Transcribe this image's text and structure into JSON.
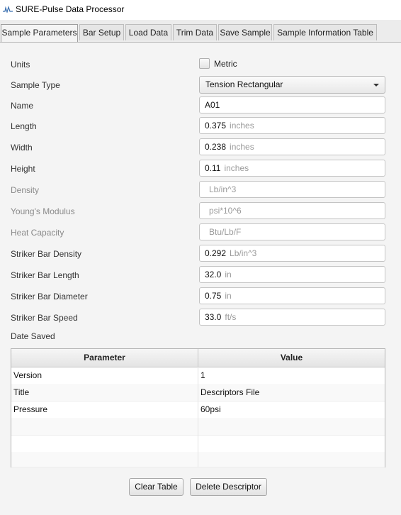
{
  "window": {
    "title": "SURE-Pulse Data Processor",
    "icon": "app-logo-icon"
  },
  "tabs": [
    {
      "label": "Sample Parameters",
      "active": true
    },
    {
      "label": "Bar Setup"
    },
    {
      "label": "Load Data"
    },
    {
      "label": "Trim Data"
    },
    {
      "label": "Save Sample"
    },
    {
      "label": "Sample Information Table"
    }
  ],
  "form": {
    "units_label": "Units",
    "metric_label": "Metric",
    "metric_checked": false,
    "sample_type_label": "Sample Type",
    "sample_type_value": "Tension Rectangular",
    "fields": [
      {
        "label": "Name",
        "value": "A01",
        "unit": ""
      },
      {
        "label": "Length",
        "value": "0.375",
        "unit": "inches"
      },
      {
        "label": "Width",
        "value": "0.238",
        "unit": "inches"
      },
      {
        "label": "Height",
        "value": "0.11",
        "unit": "inches"
      },
      {
        "label": "Density",
        "value": "",
        "unit": "Lb/in^3"
      },
      {
        "label": "Young's Modulus",
        "value": "",
        "unit": "psi*10^6"
      },
      {
        "label": "Heat Capacity",
        "value": "",
        "unit": "Btu/Lb/F"
      },
      {
        "label": "Striker Bar Density",
        "value": "0.292",
        "unit": "Lb/in^3"
      },
      {
        "label": "Striker Bar Length",
        "value": "32.0",
        "unit": "in"
      },
      {
        "label": "Striker Bar Diameter",
        "value": "0.75",
        "unit": "in"
      },
      {
        "label": "Striker Bar Speed",
        "value": "33.0",
        "unit": "ft/s"
      }
    ],
    "date_saved_label": "Date Saved"
  },
  "table": {
    "headers": [
      "Parameter",
      "Value"
    ],
    "rows": [
      [
        "Version",
        "1"
      ],
      [
        "Title",
        "Descriptors File"
      ],
      [
        "Pressure",
        "60psi"
      ],
      [
        "",
        ""
      ],
      [
        "",
        ""
      ],
      [
        "",
        ""
      ]
    ]
  },
  "buttons": {
    "clear": "Clear Table",
    "delete": "Delete Descriptor"
  },
  "colors": {
    "muted_label": "#8a8a8a",
    "placeholder_unit": "#9a9a9a",
    "panel_bg": "#f4f4f4"
  }
}
